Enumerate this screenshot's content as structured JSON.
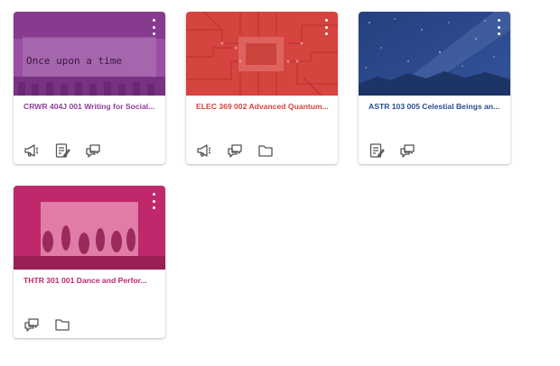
{
  "courses": [
    {
      "title": "CRWR 404J 001 Writing for Social...",
      "color": "#8e3e98",
      "hero_text": "Once upon a time",
      "actions": [
        "announcements-icon",
        "assignments-icon",
        "discussions-icon"
      ]
    },
    {
      "title": "ELEC 369 002 Advanced Quantum...",
      "color": "#d5443f",
      "actions": [
        "announcements-icon",
        "discussions-icon",
        "files-icon"
      ]
    },
    {
      "title": "ASTR 103 005 Celestial Beings an...",
      "color": "#2c4c8f",
      "actions": [
        "assignments-icon",
        "discussions-icon"
      ]
    },
    {
      "title": "THTR 301 001 Dance and Perfor...",
      "color": "#c0286b",
      "actions": [
        "discussions-icon",
        "files-icon"
      ]
    }
  ]
}
